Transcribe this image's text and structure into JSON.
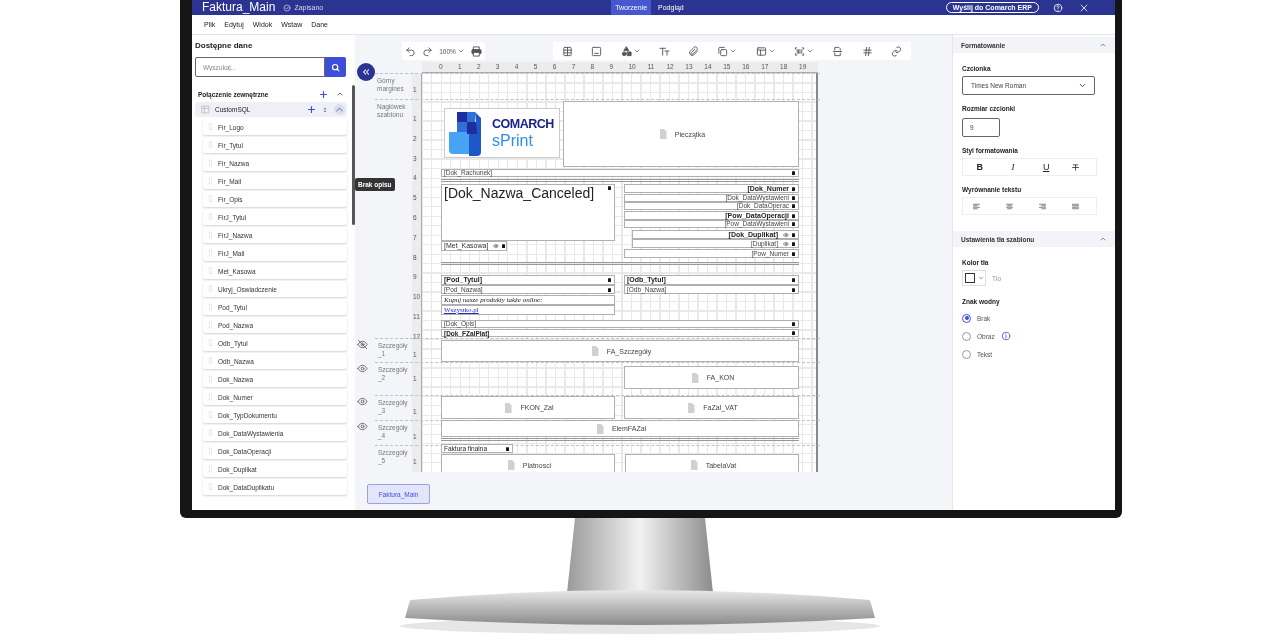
{
  "window": {
    "title": "Faktura_Main",
    "save_status": "Zapisano",
    "tabs": [
      {
        "label": "Tworzenie",
        "selected": true
      },
      {
        "label": "Podgląd",
        "selected": false
      }
    ],
    "send_button": "Wyślij do Comarch ERP"
  },
  "menu": [
    "Plik",
    "Edytuj",
    "Widok",
    "Wstaw",
    "Dane"
  ],
  "data_panel": {
    "title": "Dostępne dane",
    "search": {
      "placeholder": "Wyszukaj..."
    },
    "connection": {
      "label": "Połączenie zewnętrzne",
      "expanded": true
    },
    "source": {
      "label": "CustomSQL",
      "expanded": true
    },
    "fields": [
      "Fir_Logo",
      "Fir_Tytul",
      "Fir_Nazwa",
      "Fir_Mail",
      "Fir_Opis",
      "FirJ_Tytul",
      "FirJ_Nazwa",
      "FirJ_Mail",
      "Met_Kasowa",
      "Ukryj_Oswiadczenie",
      "Pod_Tytul",
      "Pod_Nazwa",
      "Odb_Tytul",
      "Odb_Nazwa",
      "Dok_Nazwa",
      "Dok_Numer",
      "Dok_TypDokumentu",
      "Dok_DataWystawienia",
      "Dok_DataOperacji",
      "Dok_Duplikat",
      "Dok_DataDuplikatu"
    ],
    "tooltip": "Brak opisu"
  },
  "toolbar": {
    "zoom": "100%"
  },
  "design": {
    "ruler_labels": [
      "0",
      "1",
      "2",
      "3",
      "4",
      "5",
      "6",
      "7",
      "8",
      "9",
      "10",
      "11",
      "12",
      "13",
      "14",
      "15",
      "16",
      "17",
      "18",
      "19"
    ],
    "bands": [
      {
        "label": "Górny margines",
        "ruler_labels": [
          "1"
        ]
      },
      {
        "label": "Nagłówek szablonu",
        "ruler_labels": [
          "1",
          "2",
          "3",
          "4",
          "5",
          "6",
          "7",
          "8",
          "9",
          "10",
          "11",
          "12"
        ]
      },
      {
        "label": "Szczegóły _1",
        "visible": false,
        "ruler_labels": [
          "1"
        ]
      },
      {
        "label": "Szczegóły _2",
        "visible": true,
        "ruler_labels": [
          "1"
        ]
      },
      {
        "label": "Szczegóły _3",
        "visible": true,
        "ruler_labels": [
          "1"
        ]
      },
      {
        "label": "Szczegóły _4",
        "visible": true,
        "ruler_labels": [
          "1"
        ]
      },
      {
        "label": "Szczegóły _5",
        "ruler_labels": [
          "1"
        ]
      }
    ],
    "logo": {
      "line_1": "COMARCH",
      "line_2": "sPrint"
    },
    "elements": [
      {
        "kind": "image-box",
        "text": "Pieczątka"
      },
      {
        "kind": "small-text",
        "text": "[Dok_Rachunek]"
      },
      {
        "kind": "large-text",
        "text": "[Dok_Nazwa_Canceled]"
      },
      {
        "kind": "text",
        "text": "[Met_Kasowa]"
      },
      {
        "kind": "bold-text",
        "text": "[Dok_Numer"
      },
      {
        "kind": "small-text",
        "text": "[Dok_DataWystawieni"
      },
      {
        "kind": "small-text",
        "text": "[Dok_DataOperac"
      },
      {
        "kind": "bold-text",
        "text": "[Pow_DataOperacji"
      },
      {
        "kind": "small-text",
        "text": "[Pow_DataWystawieni"
      },
      {
        "kind": "bold-text",
        "text": "[Dok_Duplikat]"
      },
      {
        "kind": "small-text",
        "text": "[Duplikat]"
      },
      {
        "kind": "small-text",
        "text": "[Pow_Numer"
      },
      {
        "kind": "bold-text",
        "text": "[Pod_Tytul]"
      },
      {
        "kind": "small-text",
        "text": "[Pod_Nazwa]"
      },
      {
        "kind": "italic-text",
        "text": "Kupuj nasze produkty także online:"
      },
      {
        "kind": "link",
        "text": "Wszystko.pl"
      },
      {
        "kind": "bold-text",
        "text": "[Odb_Tytul]"
      },
      {
        "kind": "small-text",
        "text": "[Odb_Nazwa]"
      },
      {
        "kind": "small-text",
        "text": "[Dok_Opis]"
      },
      {
        "kind": "bold-small",
        "text": "[Dok_FZalPlat]"
      },
      {
        "kind": "image-box",
        "text": "FA_Szczegóły"
      },
      {
        "kind": "image-box",
        "text": "FA_KON"
      },
      {
        "kind": "image-box",
        "text": "FKON_Zal"
      },
      {
        "kind": "image-box",
        "text": "FaZal_VAT"
      },
      {
        "kind": "image-box",
        "text": "ElemFAZal"
      },
      {
        "kind": "tiny-text",
        "text": "Faktura finalna"
      },
      {
        "kind": "image-box",
        "text": "Platnosci"
      },
      {
        "kind": "image-box",
        "text": "TabelaVat"
      }
    ]
  },
  "page_tabs": [
    {
      "label": "Faktura_Main",
      "selected": true
    }
  ],
  "format_panel": {
    "title": "Formatowanie",
    "expanded": true,
    "font_label": "Czcionka",
    "font": "Times New Roman",
    "size_label": "Rozmiar czcionki",
    "size": "9",
    "style_label": "Styl formatowania",
    "style_buttons": [
      "B",
      "I",
      "U"
    ],
    "align_label": "Wyrównanie tekstu"
  },
  "background_panel": {
    "title": "Ustawienia tła szablonu",
    "expanded": true,
    "color_label": "Kolor tła",
    "color_name": "Tło",
    "watermark_label": "Znak wodny",
    "watermark_options": [
      {
        "label": "Brak",
        "selected": true
      },
      {
        "label": "Obraz",
        "selected": false
      },
      {
        "label": "Tekst",
        "selected": false
      }
    ]
  }
}
